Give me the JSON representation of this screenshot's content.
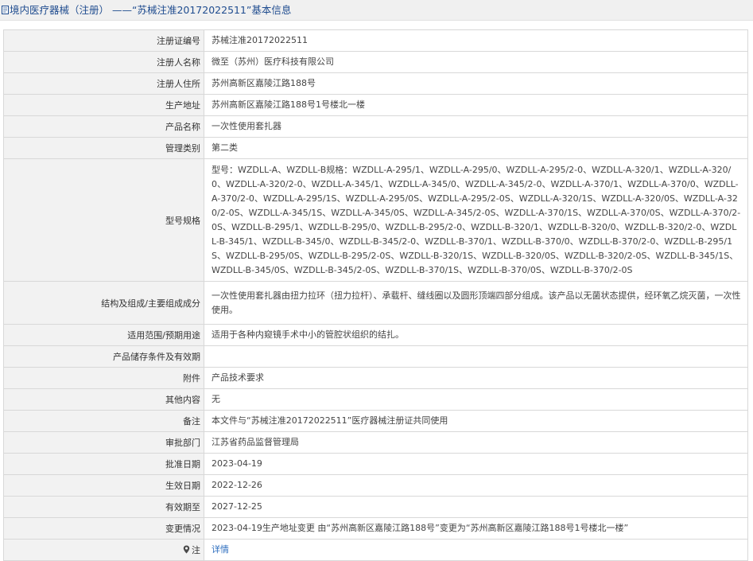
{
  "header": {
    "title": "境内医疗器械（注册） ——“苏械注准20172022511”基本信息"
  },
  "rows": [
    {
      "label": "注册证编号",
      "value": "苏械注准20172022511"
    },
    {
      "label": "注册人名称",
      "value": "微至（苏州）医疗科技有限公司"
    },
    {
      "label": "注册人住所",
      "value": "苏州高新区嘉陵江路188号"
    },
    {
      "label": "生产地址",
      "value": "苏州高新区嘉陵江路188号1号楼北一楼"
    },
    {
      "label": "产品名称",
      "value": "一次性使用套扎器"
    },
    {
      "label": "管理类别",
      "value": "第二类"
    },
    {
      "label": "型号规格",
      "value": "型号：WZDLL-A、WZDLL-B规格：WZDLL-A-295/1、WZDLL-A-295/0、WZDLL-A-295/2-0、WZDLL-A-320/1、WZDLL-A-320/0、WZDLL-A-320/2-0、WZDLL-A-345/1、WZDLL-A-345/0、WZDLL-A-345/2-0、WZDLL-A-370/1、WZDLL-A-370/0、WZDLL-A-370/2-0、WZDLL-A-295/1S、WZDLL-A-295/0S、WZDLL-A-295/2-0S、WZDLL-A-320/1S、WZDLL-A-320/0S、WZDLL-A-320/2-0S、WZDLL-A-345/1S、WZDLL-A-345/0S、WZDLL-A-345/2-0S、WZDLL-A-370/1S、WZDLL-A-370/0S、WZDLL-A-370/2-0S、WZDLL-B-295/1、WZDLL-B-295/0、WZDLL-B-295/2-0、WZDLL-B-320/1、WZDLL-B-320/0、WZDLL-B-320/2-0、WZDLL-B-345/1、WZDLL-B-345/0、WZDLL-B-345/2-0、WZDLL-B-370/1、WZDLL-B-370/0、WZDLL-B-370/2-0、WZDLL-B-295/1S、WZDLL-B-295/0S、WZDLL-B-295/2-0S、WZDLL-B-320/1S、WZDLL-B-320/0S、WZDLL-B-320/2-0S、WZDLL-B-345/1S、WZDLL-B-345/0S、WZDLL-B-345/2-0S、WZDLL-B-370/1S、WZDLL-B-370/0S、WZDLL-B-370/2-0S"
    },
    {
      "label": "结构及组成/主要组成成分",
      "value": "一次性使用套扎器由扭力拉环（扭力拉杆）、承载杆、缝线圈以及圆形顶端四部分组成。该产品以无菌状态提供，经环氧乙烷灭菌，一次性使用。"
    },
    {
      "label": "适用范围/预期用途",
      "value": "适用于各种内窥镜手术中小的管腔状组织的结扎。"
    },
    {
      "label": "产品储存条件及有效期",
      "value": ""
    },
    {
      "label": "附件",
      "value": "产品技术要求"
    },
    {
      "label": "其他内容",
      "value": "无"
    },
    {
      "label": "备注",
      "value": "本文件与“苏械注准20172022511”医疗器械注册证共同使用"
    },
    {
      "label": "审批部门",
      "value": "江苏省药品监督管理局"
    },
    {
      "label": "批准日期",
      "value": "2023-04-19"
    },
    {
      "label": "生效日期",
      "value": "2022-12-26"
    },
    {
      "label": "有效期至",
      "value": "2027-12-25"
    },
    {
      "label": "变更情况",
      "value": "2023-04-19生产地址变更 由“苏州高新区嘉陵江路188号”变更为“苏州高新区嘉陵江路188号1号楼北一楼”"
    },
    {
      "label": "注",
      "value": "详情",
      "icon": "location-pin-icon"
    }
  ]
}
